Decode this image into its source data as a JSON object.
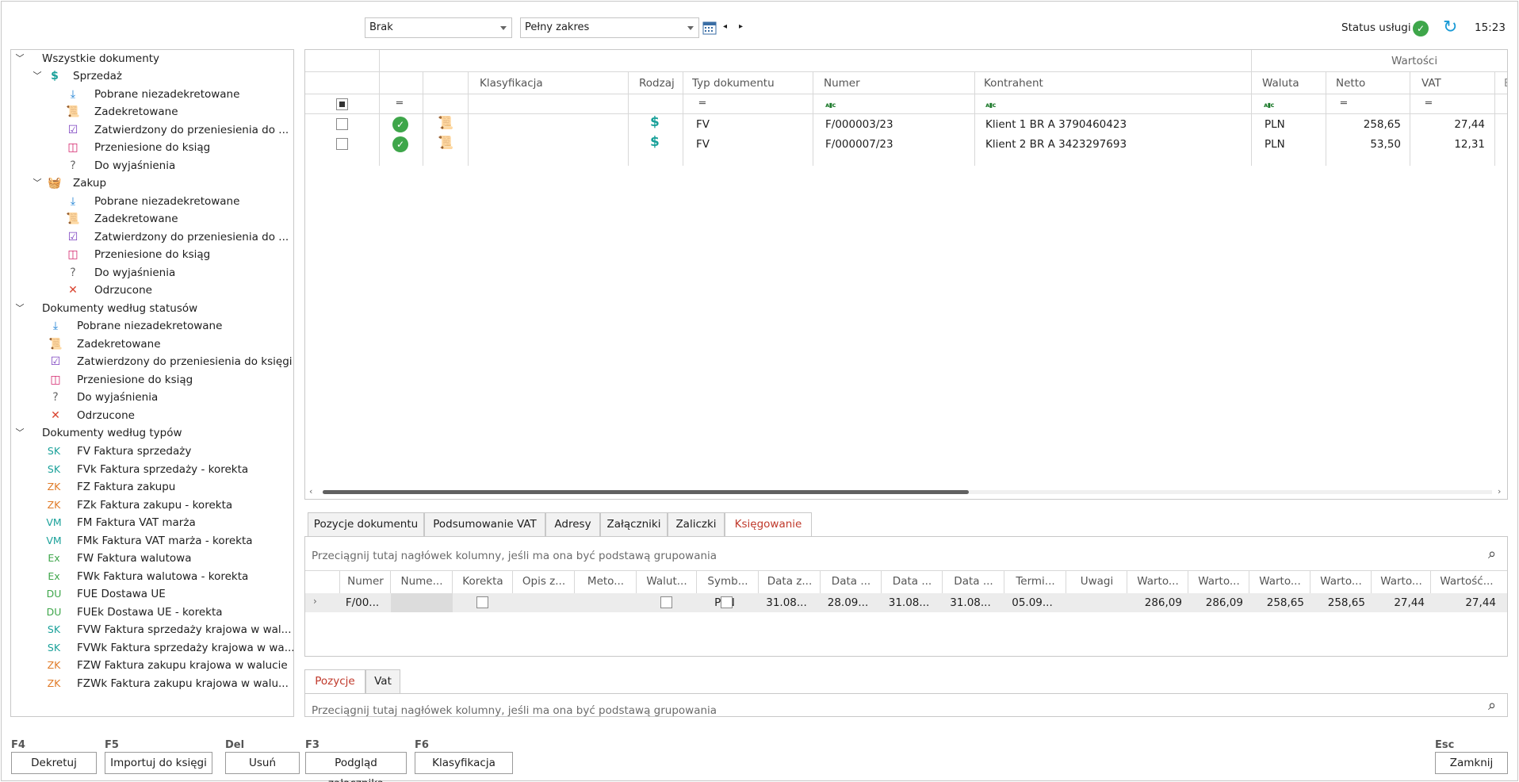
{
  "toolbar": {
    "filter1": "Brak",
    "filter2": "Pełny zakres",
    "status_label": "Status usługi",
    "time": "15:23"
  },
  "tree": {
    "root": "Wszystkie dokumenty",
    "sales": "Sprzedaż",
    "sales_items": [
      "Pobrane niezadekretowane",
      "Zadekretowane",
      "Zatwierdzony do przeniesienia do ...",
      "Przeniesione do ksiąg",
      "Do wyjaśnienia"
    ],
    "purchase": "Zakup",
    "purchase_items": [
      "Pobrane niezadekretowane",
      "Zadekretowane",
      "Zatwierdzony do przeniesienia do ...",
      "Przeniesione do ksiąg",
      "Do wyjaśnienia",
      "Odrzucone"
    ],
    "by_status": "Dokumenty według statusów",
    "status_items": [
      "Pobrane niezadekretowane",
      "Zadekretowane",
      "Zatwierdzony do przeniesienia do księgi",
      "Przeniesione do ksiąg",
      "Do wyjaśnienia",
      "Odrzucone"
    ],
    "by_type": "Dokumenty według typów",
    "type_items": [
      {
        "code": "SK",
        "label": "FV Faktura sprzedaży"
      },
      {
        "code": "SK",
        "label": "FVk Faktura sprzedaży - korekta"
      },
      {
        "code": "ZK",
        "label": "FZ Faktura zakupu"
      },
      {
        "code": "ZK",
        "label": "FZk Faktura zakupu - korekta"
      },
      {
        "code": "VM",
        "label": "FM Faktura VAT marża"
      },
      {
        "code": "VM",
        "label": "FMk Faktura VAT marża - korekta"
      },
      {
        "code": "Ex",
        "label": "FW Faktura walutowa"
      },
      {
        "code": "Ex",
        "label": "FWk Faktura walutowa - korekta"
      },
      {
        "code": "DU",
        "label": "FUE Dostawa UE"
      },
      {
        "code": "DU",
        "label": "FUEk Dostawa UE - korekta"
      },
      {
        "code": "SK",
        "label": "FVW Faktura sprzedaży krajowa w wal..."
      },
      {
        "code": "SK",
        "label": "FVWk Faktura sprzedaży krajowa w wa..."
      },
      {
        "code": "ZK",
        "label": "FZW Faktura zakupu krajowa w walucie"
      },
      {
        "code": "ZK",
        "label": "FZWk Faktura zakupu krajowa w walu..."
      }
    ]
  },
  "grid": {
    "group_header": "Wartości",
    "columns": [
      "Klasyfikacja",
      "Rodzaj",
      "Typ dokumentu",
      "Numer",
      "Kontrahent",
      "Waluta",
      "Netto",
      "VAT"
    ],
    "rows": [
      {
        "typ": "FV",
        "numer": "F/000003/23",
        "kontrahent": "Klient 1 BR A 3790460423",
        "waluta": "PLN",
        "netto": "258,65",
        "vat": "27,44"
      },
      {
        "typ": "FV",
        "numer": "F/000007/23",
        "kontrahent": "Klient 2 BR A 3423297693",
        "waluta": "PLN",
        "netto": "53,50",
        "vat": "12,31"
      }
    ]
  },
  "tabs": [
    "Pozycje dokumentu",
    "Podsumowanie VAT",
    "Adresy",
    "Załączniki",
    "Zaliczki",
    "Księgowanie"
  ],
  "booking": {
    "hint": "Przeciągnij tutaj nagłówek kolumny, jeśli ma ona być podstawą grupowania",
    "columns": [
      "Numer",
      "Nume...",
      "Korekta",
      "Opis z...",
      "Meto...",
      "Walut...",
      "Symb...",
      "Data z...",
      "Data ...",
      "Data ...",
      "Data ...",
      "Termi...",
      "Uwagi",
      "Warto...",
      "Warto...",
      "Warto...",
      "Warto...",
      "Warto...",
      "Wartość..."
    ],
    "row": {
      "numer": "F/00...",
      "symbol": "PLN",
      "d1": "31.08...",
      "d2": "28.09...",
      "d3": "31.08...",
      "d4": "31.08...",
      "termin": "05.09...",
      "w1": "286,09",
      "w2": "286,09",
      "w3": "258,65",
      "w4": "258,65",
      "w5": "27,44",
      "w6": "27,44"
    }
  },
  "subtabs": [
    "Pozycje",
    "Vat"
  ],
  "sub_hint": "Przeciągnij tutaj nagłówek kolumny, jeśli ma ona być podstawą grupowania",
  "buttons": [
    {
      "key": "F4",
      "label": "Dekretuj"
    },
    {
      "key": "F5",
      "label": "Importuj do księgi"
    },
    {
      "key": "Del",
      "label": "Usuń"
    },
    {
      "key": "F3",
      "label": "Podgląd załącznika"
    },
    {
      "key": "F6",
      "label": "Klasyfikacja"
    },
    {
      "key": "Esc",
      "label": "Zamknij"
    }
  ],
  "colors": {
    "accent_red": "#c0392b",
    "green": "#3ea64a",
    "blue": "#1a7fd4",
    "purple": "#7a3fbf",
    "pink": "#d4246b",
    "orange": "#e07b28"
  }
}
